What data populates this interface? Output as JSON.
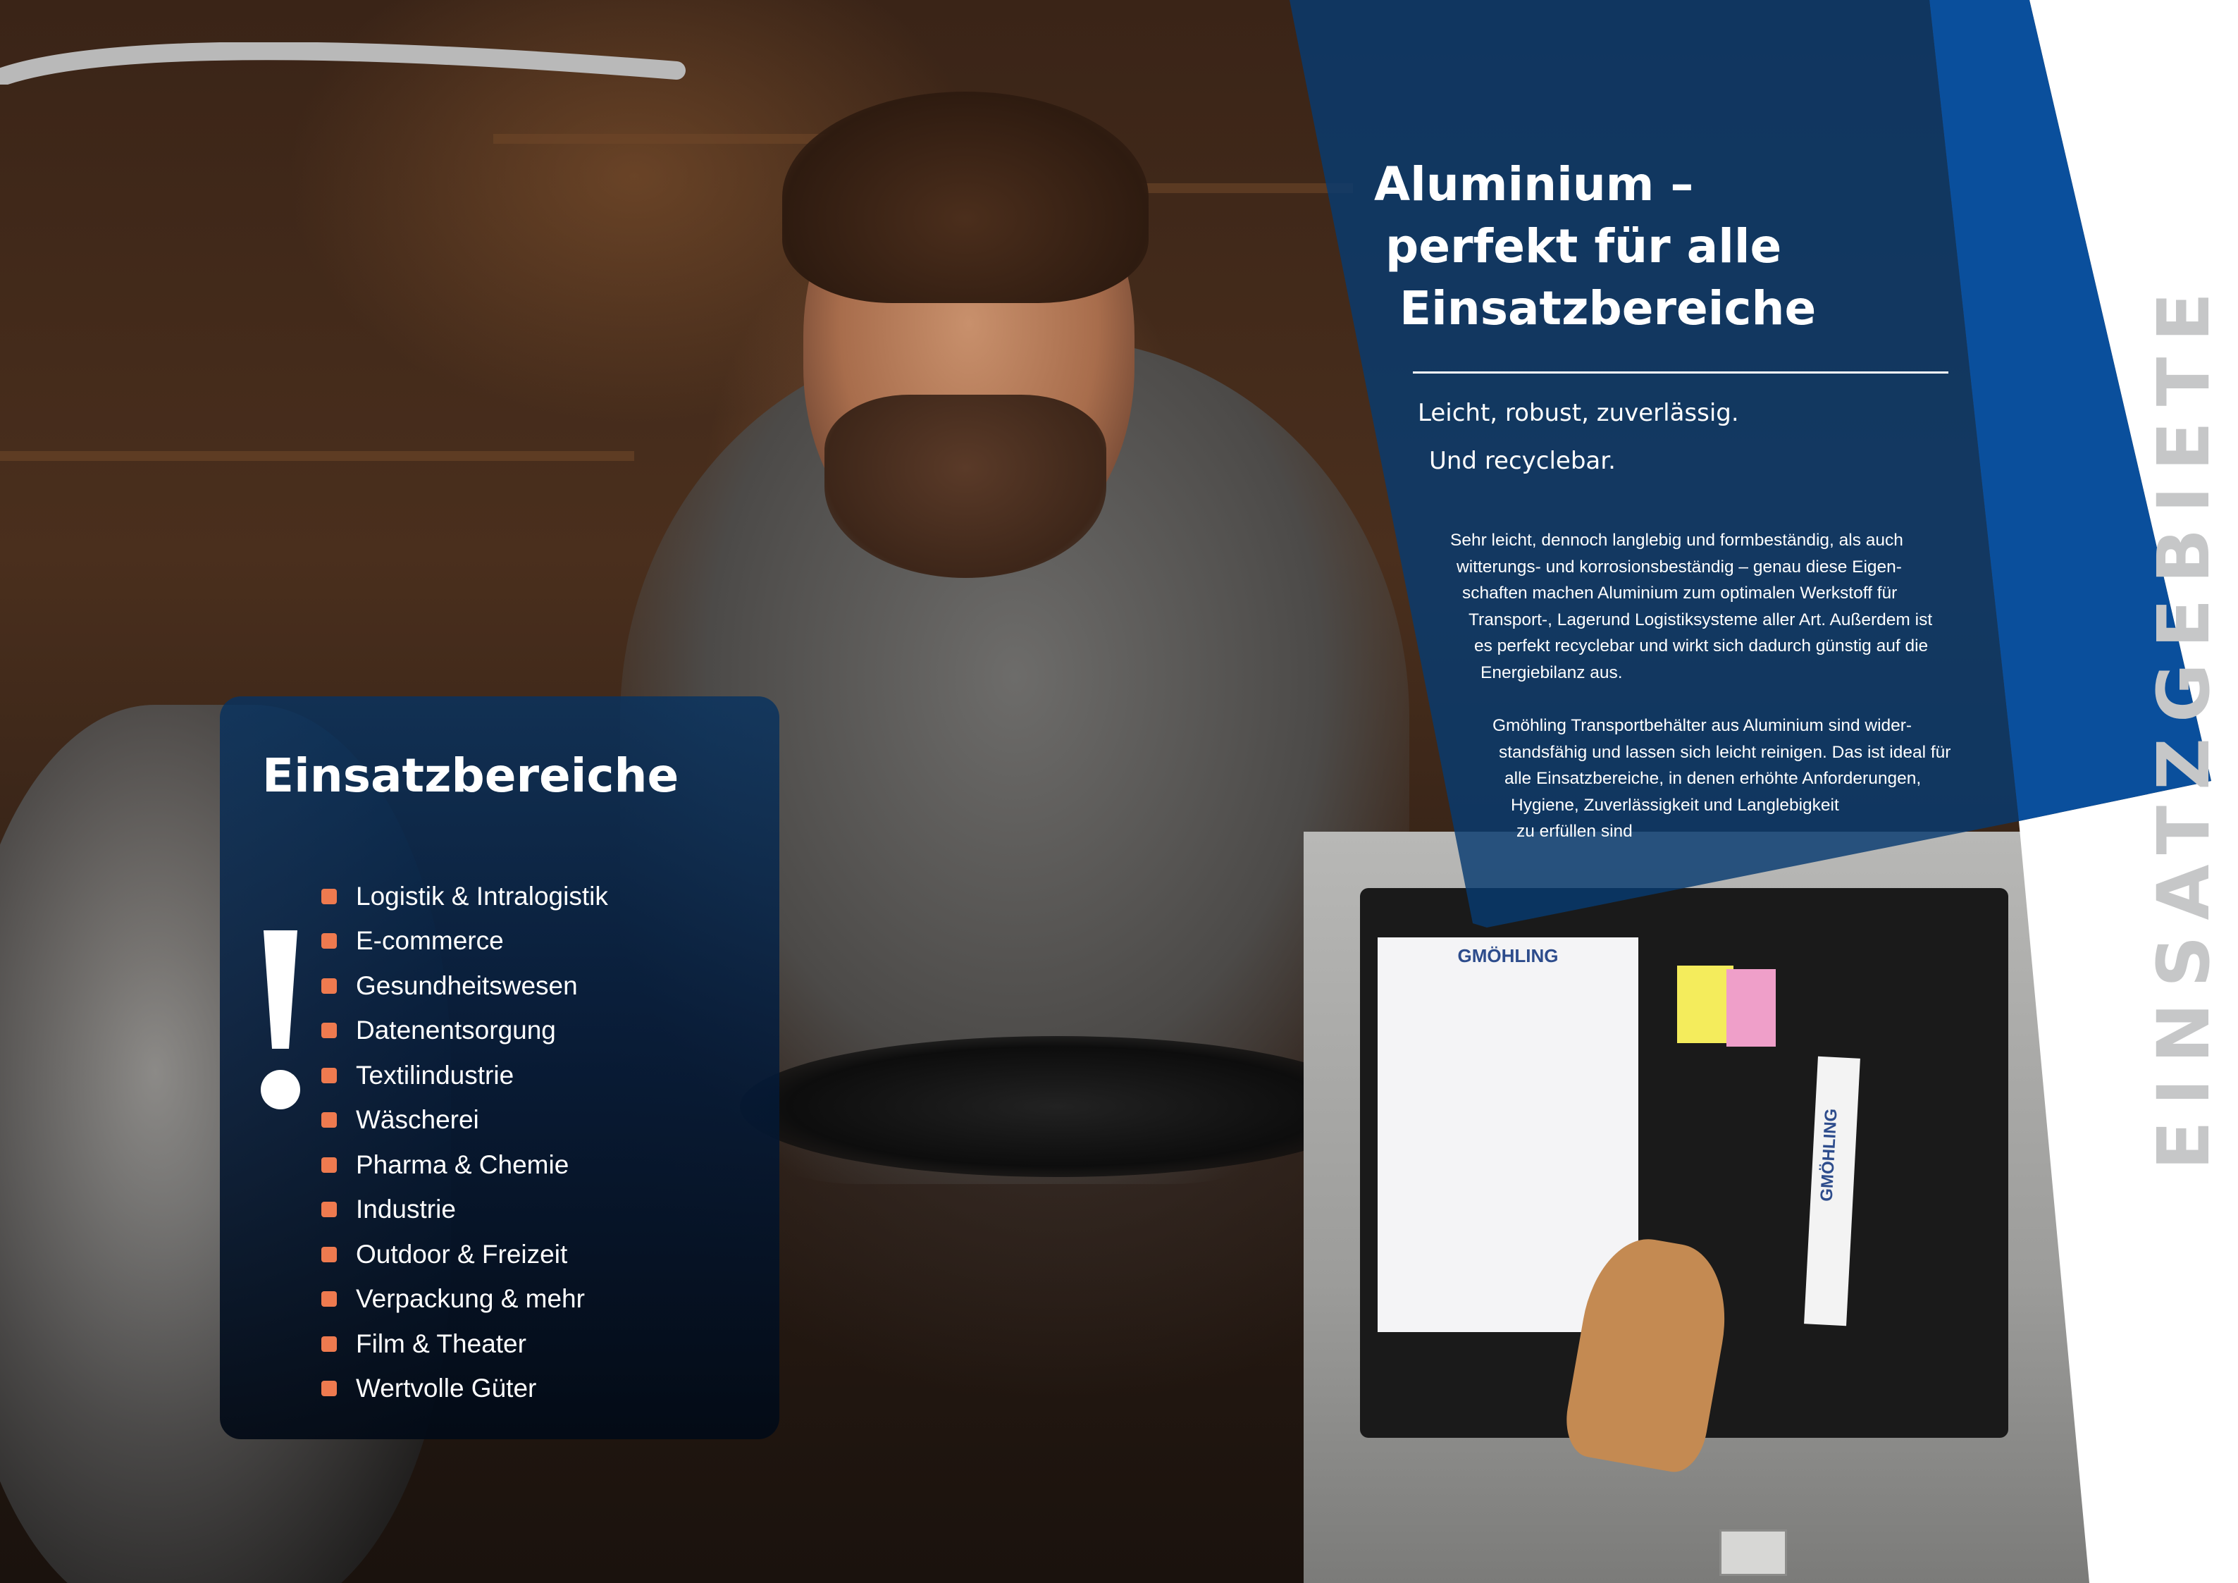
{
  "intro": {
    "title_lines": [
      "Aluminium –",
      "perfekt für alle",
      "Einsatzbereiche"
    ],
    "tagline_1": "Leicht, robust, zuverlässig.",
    "tagline_2": "Und recyclebar.",
    "paragraph_1": [
      "Sehr leicht, dennoch langlebig und formbeständig, als auch",
      "witterungs- und korrosionsbeständig – genau diese Eigen-",
      "schaften machen Aluminium zum optimalen Werkstoff für",
      "Transport-, Lagerund Logistiksysteme aller Art. Außerdem ist",
      "es perfekt recyclebar und wirkt sich dadurch günstig auf die",
      "Energiebilanz aus."
    ],
    "paragraph_2": [
      "Gmöhling Transportbehälter aus Aluminium sind wider-",
      "standsfähig und lassen sich leicht reinigen. Das ist ideal für",
      "alle Einsatzbereiche, in denen erhöhte Anforderungen,",
      "Hygiene, Zuverlässigkeit und Langlebigkeit",
      "zu erfüllen sind"
    ]
  },
  "side_label": "EINSATZGEBIETE",
  "photo": {
    "notepad_brand": "GMÖHLING",
    "ruler_brand": "GMÖHLING"
  },
  "areas": {
    "title": "Einsatzbereiche",
    "icon": "exclamation-icon",
    "items": [
      "Logistik & Intralogistik",
      "E-commerce",
      "Gesundheitswesen",
      "Datenentsorgung",
      "Textilindustrie",
      "Wäscherei",
      "Pharma & Chemie",
      "Industrie",
      "Outdoor & Freizeit",
      "Verpackung & mehr",
      "Film & Theater",
      "Wertvolle Güter"
    ]
  },
  "colors": {
    "brand_blue": "#0a4f9c",
    "dark_blue": "#073a70",
    "bullet_orange": "#ee7a4f",
    "side_label_gray": "#c6c7c8"
  }
}
